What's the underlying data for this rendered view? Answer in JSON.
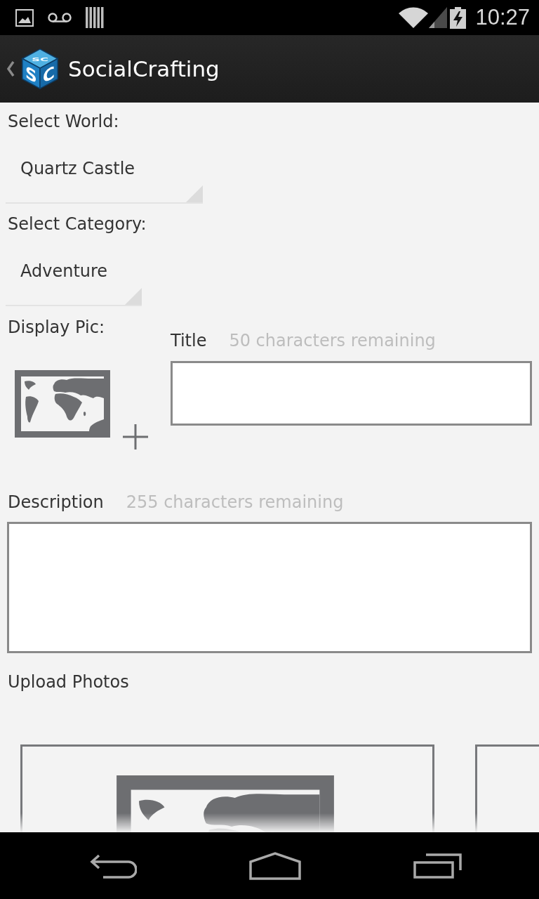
{
  "status_bar": {
    "time": "10:27"
  },
  "action_bar": {
    "logo_letters": {
      "top": "SC",
      "left": "S",
      "right": "C"
    },
    "title": "SocialCrafting"
  },
  "world_select": {
    "label": "Select World:",
    "value": "Quartz Castle"
  },
  "category_select": {
    "label": "Select Category:",
    "value": "Adventure"
  },
  "display_pic": {
    "label": "Display Pic:"
  },
  "title_field": {
    "label": "Title",
    "counter": "50 characters remaining"
  },
  "description_field": {
    "label": "Description",
    "counter": "255 characters remaining"
  },
  "upload_photos": {
    "label": "Upload Photos"
  }
}
